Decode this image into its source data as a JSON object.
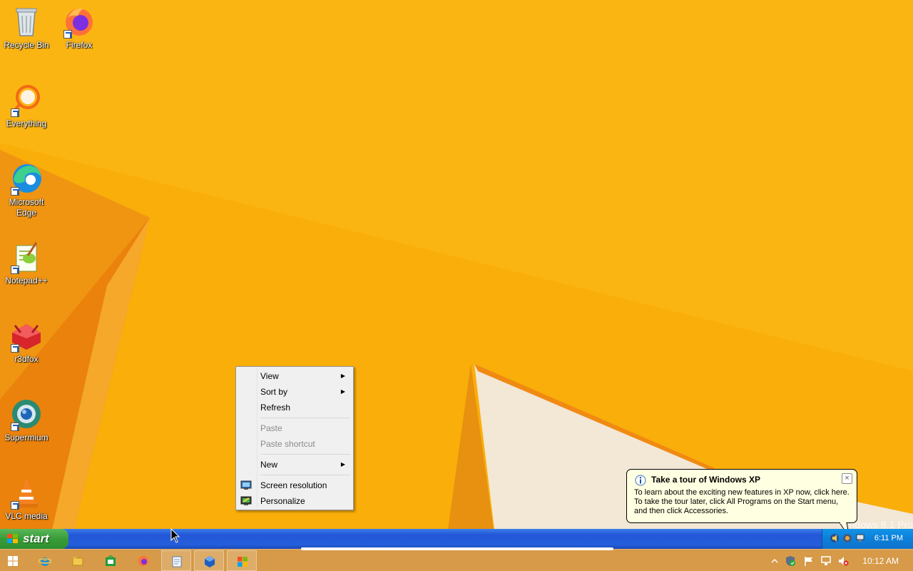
{
  "desktop": {
    "icons": [
      {
        "label": "Recycle Bin"
      },
      {
        "label": "Firefox"
      },
      {
        "label": "Everything"
      },
      {
        "label": "Microsoft Edge"
      },
      {
        "label": "Notepad++"
      },
      {
        "label": "r3dfox"
      },
      {
        "label": "Supermium"
      },
      {
        "label": "VLC media"
      }
    ]
  },
  "context_menu": {
    "view": "View",
    "sort_by": "Sort by",
    "refresh": "Refresh",
    "paste": "Paste",
    "paste_shortcut": "Paste shortcut",
    "new": "New",
    "screen_resolution": "Screen resolution",
    "personalize": "Personalize"
  },
  "balloon": {
    "title": "Take a tour of Windows XP",
    "body": "To learn about the exciting new features in XP now, click here. To take the tour later, click All Programs on the Start menu, and then click Accessories.",
    "close": "×"
  },
  "xp_taskbar": {
    "start_label": "start",
    "clock": "6:11 PM"
  },
  "watermark": "Windows 8.1 Pro",
  "w8_taskbar": {
    "clock": "10:12 AM"
  },
  "colors": {
    "wallpaper": "#f7a406",
    "xp_taskbar": "#245edb",
    "xp_start": "#379c37",
    "balloon": "#ffffe1",
    "w8_taskbar": "#d69a48"
  }
}
